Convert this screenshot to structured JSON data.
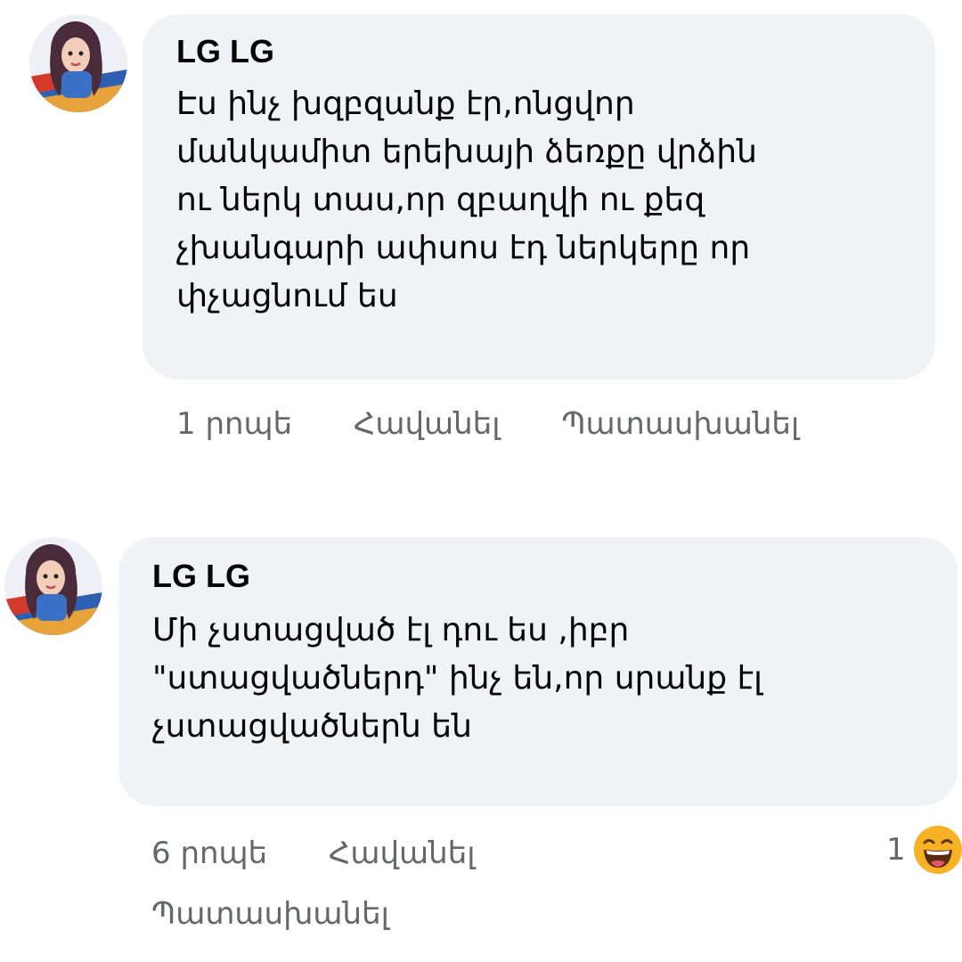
{
  "comments": [
    {
      "author": "LG LG",
      "text": "Էս ինչ խզբզանք էր,ոնցվոր\nմանկամիտ երեխայի ձեռքը վրձին\nու ներկ տաս,որ զբաղվի ու քեզ\nչխանգարի ափսոս էդ ներկերը որ\nփչացնում ես",
      "time": "1 րոպե",
      "like_label": "Հավանել",
      "reply_label": "Պատասխանել"
    },
    {
      "author": "LG LG",
      "text": "Մի չստացված էլ դու ես ,իբր\n\"ստացվածներդ\" ինչ են,որ սրանք էլ\nչստացվածներն են",
      "time": "6 րոպե",
      "like_label": "Հավանել",
      "reply_label": "Պատասխանել",
      "reaction": {
        "count": "1",
        "icon": "laughing-emoji-icon"
      }
    }
  ],
  "colors": {
    "bubble": "#f0f2f5",
    "meta_text": "#65676b",
    "text": "#050505",
    "emoji": "#f7b125"
  }
}
